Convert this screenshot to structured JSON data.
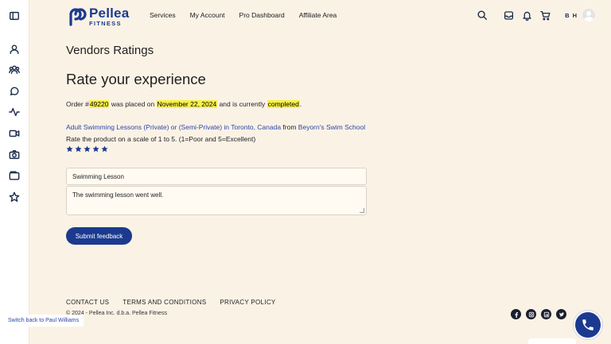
{
  "brand": {
    "name": "Pellea",
    "sub": "FITNESS",
    "accent_color": "#1b3a8f"
  },
  "nav": {
    "items": [
      "Services",
      "My Account",
      "Pro Dashboard",
      "Affiliate Area"
    ]
  },
  "header": {
    "initials": "B H",
    "icons": [
      "search-icon",
      "inbox-icon",
      "bell-icon",
      "cart-icon",
      "avatar"
    ]
  },
  "sidebar": {
    "icons": [
      "sidebar-toggle-icon",
      "user-icon",
      "group-icon",
      "chat-icon",
      "activity-icon",
      "video-icon",
      "camera-icon",
      "folder-icon",
      "star-icon"
    ]
  },
  "page": {
    "title": "Vendors Ratings",
    "section_title": "Rate your experience",
    "order": {
      "prefix": "Order #",
      "number": "49220",
      "placed_text": " was placed on ",
      "date": "November 22, 2024",
      "status_text": " and is currently ",
      "status": "completed",
      "suffix": "."
    },
    "product": {
      "name": "Adult Swimming Lessons (Private) or (Semi-Private) in Toronto, Canada",
      "from_text": " from ",
      "vendor": "Beyorn's Swim School"
    },
    "scale_text": "Rate the product on a scale of 1 to 5. (1=Poor and 5=Excellent)",
    "rating": 5,
    "rating_max": 5,
    "review_title_value": "Swimming Lesson",
    "review_body_value": "The swimming lesson went well.",
    "submit_label": "Submit feedback"
  },
  "footer": {
    "links": [
      "CONTACT US",
      "TERMS AND CONDITIONS",
      "PRIVACY POLICY"
    ],
    "copyright": "© 2024 - Pellea Inc. d.b.a. Pellea Fitness",
    "social_icons": [
      "facebook-icon",
      "instagram-icon",
      "linkedin-icon",
      "twitter-icon"
    ]
  },
  "switch_back_label": "Switch back to Paul Williams"
}
